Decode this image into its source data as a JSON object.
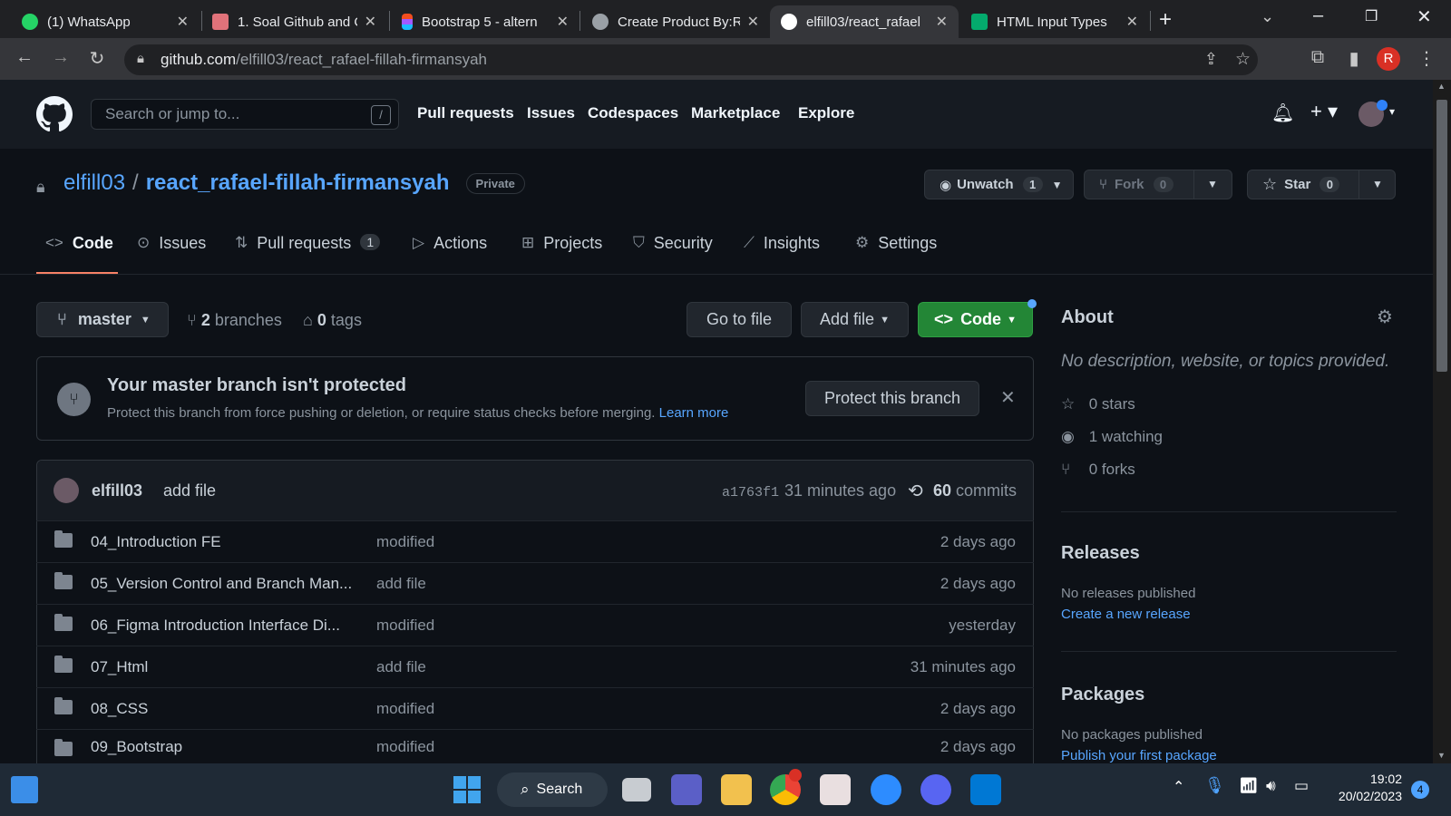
{
  "browser": {
    "tabs": [
      {
        "title": "(1) WhatsApp",
        "icon": "whatsapp-icon",
        "color": "#25d366"
      },
      {
        "title": "1. Soal Github and C",
        "icon": "doc-icon",
        "color": "#e0727a"
      },
      {
        "title": "Bootstrap 5 - altern",
        "icon": "figma-icon",
        "color": "#f24e1e"
      },
      {
        "title": "Create Product By:R",
        "icon": "globe-icon",
        "color": "#9aa0a6"
      },
      {
        "title": "elfill03/react_rafael",
        "icon": "github-icon",
        "color": "#ffffff"
      },
      {
        "title": "HTML Input Types",
        "icon": "w3schools-icon",
        "color": "#04aa6d"
      }
    ],
    "url_host": "github.com",
    "url_path": "/elfill03/react_rafael-fillah-firmansyah",
    "profile_initial": "R"
  },
  "header": {
    "search_placeholder": "Search or jump to...",
    "slash_key": "/",
    "nav": [
      "Pull requests",
      "Issues",
      "Codespaces",
      "Marketplace",
      "Explore"
    ]
  },
  "repo": {
    "owner": "elfill03",
    "separator": "/",
    "name": "react_rafael-fillah-firmansyah",
    "visibility": "Private",
    "unwatch_label": "Unwatch",
    "watch_count": "1",
    "fork_label": "Fork",
    "fork_count": "0",
    "star_label": "Star",
    "star_count": "0"
  },
  "tabs": [
    {
      "label": "Code",
      "icon": "code-icon"
    },
    {
      "label": "Issues",
      "icon": "issue-icon"
    },
    {
      "label": "Pull requests",
      "icon": "pr-icon",
      "count": "1"
    },
    {
      "label": "Actions",
      "icon": "play-icon"
    },
    {
      "label": "Projects",
      "icon": "table-icon"
    },
    {
      "label": "Security",
      "icon": "shield-icon"
    },
    {
      "label": "Insights",
      "icon": "graph-icon"
    },
    {
      "label": "Settings",
      "icon": "gear-icon"
    }
  ],
  "toolbar": {
    "branch": "master",
    "branches_count": "2",
    "branches_label": "branches",
    "tags_count": "0",
    "tags_label": "tags",
    "go_to_file": "Go to file",
    "add_file": "Add file",
    "code": "Code"
  },
  "protect": {
    "title": "Your master branch isn't protected",
    "body": "Protect this branch from force pushing or deletion, or require status checks before merging.",
    "learn_more": "Learn more",
    "button": "Protect this branch"
  },
  "commit": {
    "author": "elfill03",
    "message": "add file",
    "hash": "a1763f1",
    "age": "31 minutes ago",
    "commits_count": "60",
    "commits_label": "commits"
  },
  "files": [
    {
      "name": "04_Introduction FE",
      "message": "modified",
      "age": "2 days ago"
    },
    {
      "name": "05_Version Control and Branch Man...",
      "message": "add file",
      "age": "2 days ago"
    },
    {
      "name": "06_Figma Introduction Interface Di...",
      "message": "modified",
      "age": "yesterday"
    },
    {
      "name": "07_Html",
      "message": "add file",
      "age": "31 minutes ago"
    },
    {
      "name": "08_CSS",
      "message": "modified",
      "age": "2 days ago"
    },
    {
      "name": "09_Bootstrap",
      "message": "modified",
      "age": "2 days ago"
    }
  ],
  "about": {
    "heading": "About",
    "description": "No description, website, or topics provided.",
    "stars": "0 stars",
    "watching": "1 watching",
    "forks": "0 forks"
  },
  "releases": {
    "heading": "Releases",
    "none": "No releases published",
    "link": "Create a new release"
  },
  "packages": {
    "heading": "Packages",
    "none": "No packages published",
    "link": "Publish your first package"
  },
  "taskbar": {
    "search_label": "Search",
    "time": "19:02",
    "date": "20/02/2023",
    "notification_count": "4"
  }
}
